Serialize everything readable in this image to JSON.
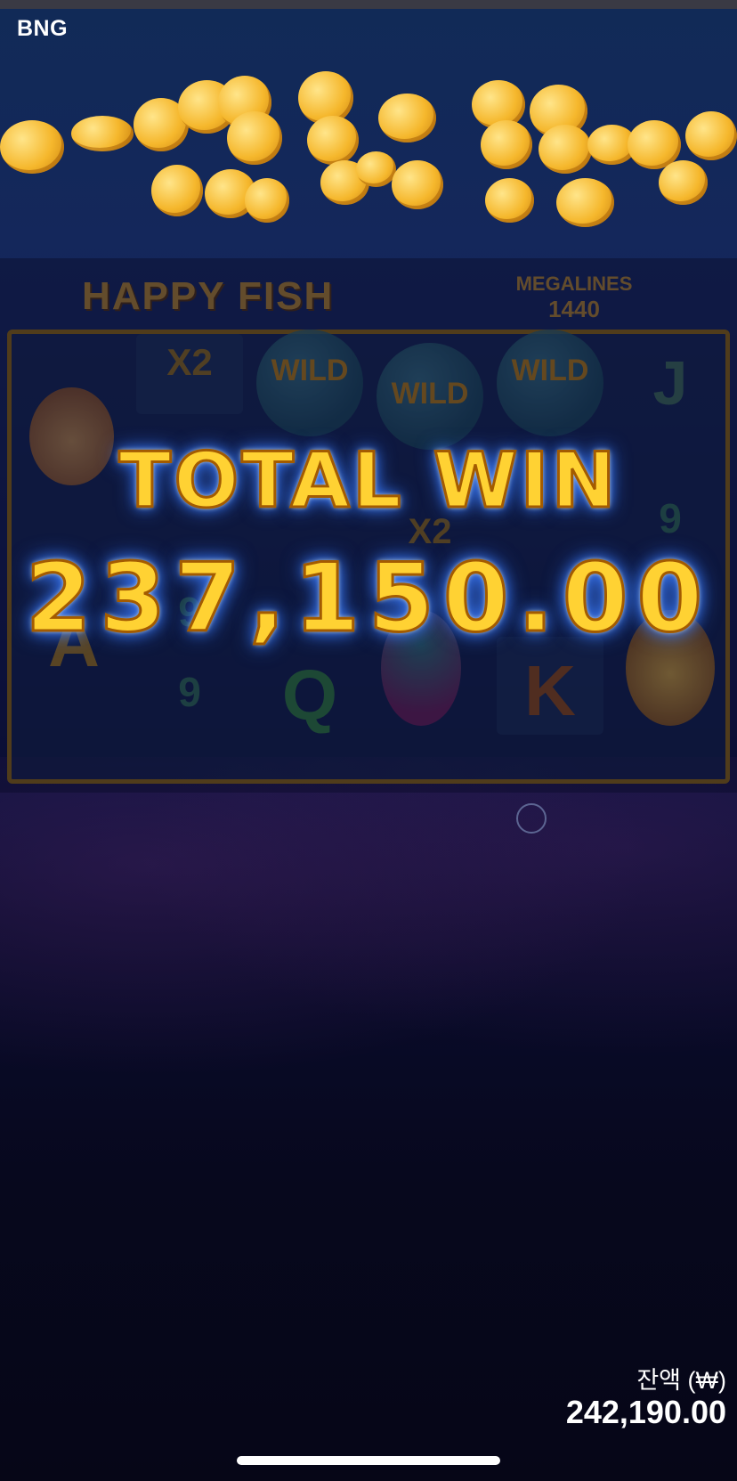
{
  "brand": "BNG",
  "game": {
    "logo": "HAPPY FISH",
    "megalines_label": "MEGALINES",
    "megalines_value": "1440"
  },
  "reels": {
    "multiplier_1": "X2",
    "multiplier_2": "X2",
    "wild_label": "WILD",
    "symbols": {
      "j": "J",
      "a": "A",
      "q": "Q",
      "k": "K",
      "nine": "9",
      "nine_2": "9",
      "nine_3": "9"
    }
  },
  "win": {
    "label": "TOTAL WIN",
    "amount": "237,150.00"
  },
  "balance": {
    "label": "잔액 (₩)",
    "value": "242,190.00"
  },
  "colors": {
    "win_text": "#ffd233",
    "win_glow": "#3b7cff",
    "background": "#0a0c2e"
  }
}
